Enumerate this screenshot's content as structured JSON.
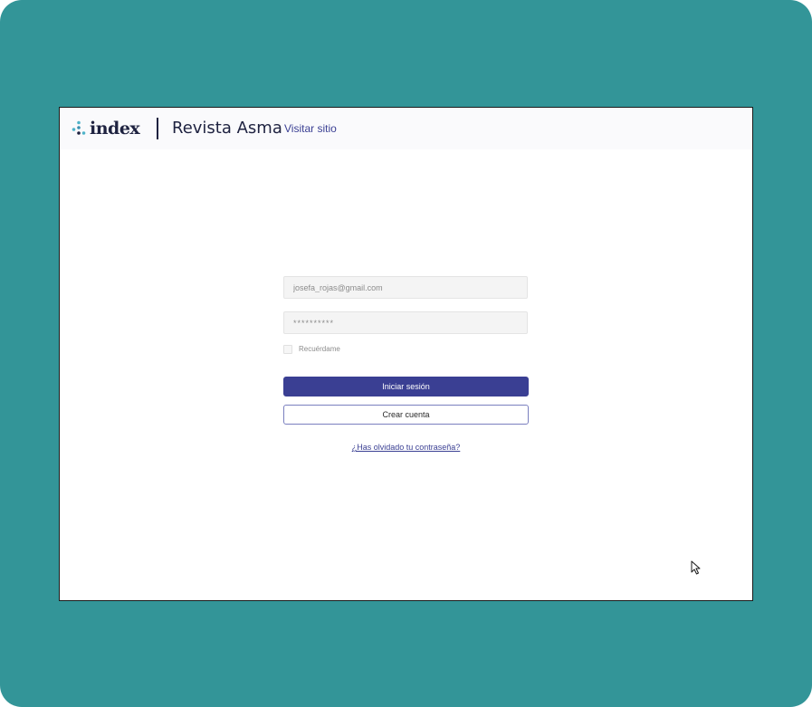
{
  "header": {
    "logo_text": "index",
    "site_name": "Revista Asma",
    "visit_link": "Visitar sitio"
  },
  "login": {
    "email_value": "josefa_rojas@gmail.com",
    "password_value": "**********",
    "remember_label": "Recuérdame",
    "remember_checked": false,
    "login_button": "Iniciar sesión",
    "create_button": "Crear cuenta",
    "forgot_link": "¿Has olvidado tu contraseña?"
  },
  "colors": {
    "background": "#339598",
    "primary": "#3a3f93",
    "logo_dots": "#4fb3c9"
  },
  "icons": {
    "logo_mark": "dots-logo-icon",
    "pointer": "mouse-pointer-icon"
  }
}
